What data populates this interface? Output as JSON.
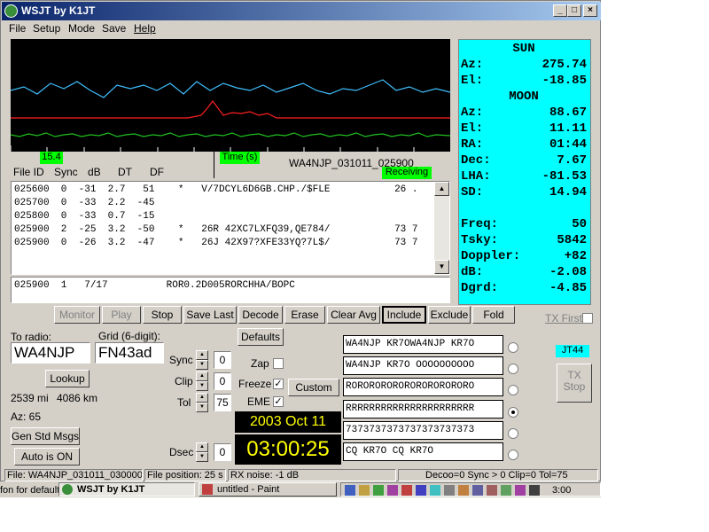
{
  "window": {
    "title": "WSJT    by K1JT",
    "buttons": {
      "minimize": "_",
      "maximize": "□",
      "close": "×"
    }
  },
  "menu": [
    "File",
    "Setup",
    "Mode",
    "Save",
    "Help"
  ],
  "spectrum": {
    "left_label": "15.4",
    "time_label": "Time (s)",
    "file_label": "WA4NJP_031011_025900",
    "status": "Receiving"
  },
  "decode_headers": [
    "File ID",
    "Sync",
    "dB",
    "DT",
    "DF"
  ],
  "decode_lines": [
    "025600  0  -31  2.7   51    *   V/7DCYL6D6GB.CHP./$FLE           26 .",
    "025700  0  -33  2.2  -45",
    "025800  0  -33  0.7  -15",
    "025900  2  -25  3.2  -50    *   26R 42XC7LXFQ39,QE784/           73 7",
    "025900  0  -26  3.2  -47    *   26J 42X97?XFE33YQ?7L$/           73 7"
  ],
  "avg_line": "025900  1   7/17          ROR0.2D005RORCHHA/BOPC",
  "astro": {
    "sun_head": "SUN",
    "moon_head": "MOON",
    "sun": [
      {
        "k": "Az:",
        "v": "275.74"
      },
      {
        "k": "El:",
        "v": "-18.85"
      }
    ],
    "moon": [
      {
        "k": "Az:",
        "v": "88.67"
      },
      {
        "k": "El:",
        "v": "11.11"
      },
      {
        "k": "RA:",
        "v": "01:44"
      },
      {
        "k": "Dec:",
        "v": "7.67"
      },
      {
        "k": "LHA:",
        "v": "-81.53"
      },
      {
        "k": "SD:",
        "v": "14.94"
      }
    ],
    "extra": [
      {
        "k": "Freq:",
        "v": "50"
      },
      {
        "k": "Tsky:",
        "v": "5842"
      },
      {
        "k": "Doppler:",
        "v": "+82"
      },
      {
        "k": "dB:",
        "v": "-2.08"
      },
      {
        "k": "Dgrd:",
        "v": "-4.85"
      }
    ]
  },
  "buttons": {
    "monitor": "Monitor",
    "play": "Play",
    "stop": "Stop",
    "save_last": "Save Last",
    "decode": "Decode",
    "erase": "Erase",
    "clear_avg": "Clear Avg",
    "include": "Include",
    "exclude": "Exclude",
    "fold": "Fold",
    "defaults": "Defaults",
    "lookup": "Lookup",
    "gen_std_msgs": "Gen Std Msgs",
    "auto": "Auto is ON",
    "custom": "Custom",
    "tx_stop": "TX\nStop"
  },
  "tx_first": "TX First",
  "mode_badge": "JT44",
  "to_radio": {
    "label": "To radio:",
    "value": "WA4NJP"
  },
  "grid": {
    "label": "Grid (6-digit):",
    "value": "FN43ad"
  },
  "distance": {
    "mi": "2539 mi",
    "km": "4086 km",
    "az": "Az: 65"
  },
  "controls": {
    "sync": {
      "label": "Sync",
      "value": "0"
    },
    "clip": {
      "label": "Clip",
      "value": "0"
    },
    "tol": {
      "label": "Tol",
      "value": "75"
    },
    "dsec": {
      "label": "Dsec",
      "value": "0"
    },
    "zap": "Zap",
    "freeze": "Freeze",
    "eme": "EME"
  },
  "clock": {
    "date": "2003 Oct 11",
    "time": "03:00:25"
  },
  "tx_messages": [
    "WA4NJP KR7OWA4NJP KR7O",
    "WA4NJP KR7O OOOOOOOOOO",
    "RORORORORORORORORORORO",
    "RRRRRRRRRRRRRRRRRRRRRR",
    "7373737373737373737373",
    "CQ KR7O     CQ KR7O"
  ],
  "status_bar": {
    "file": "File: WA4NJP_031011_030000",
    "pos": "File position: 25 s",
    "rx": "RX noise: -1 dB",
    "right": "Decoo=0  Sync > 0  Clip=0  Tol=75"
  },
  "taskbar": {
    "tray_left": "fon for default",
    "item1": "WSJT    by K1JT",
    "item2": "untitled - Paint",
    "clock": "3:00"
  },
  "colors": {
    "astro_bg": "#00ffff",
    "spectrum_bg": "#000000",
    "status_green": "#00ff00",
    "clock_bg": "#000000",
    "clock_fg": "#ffff00"
  }
}
